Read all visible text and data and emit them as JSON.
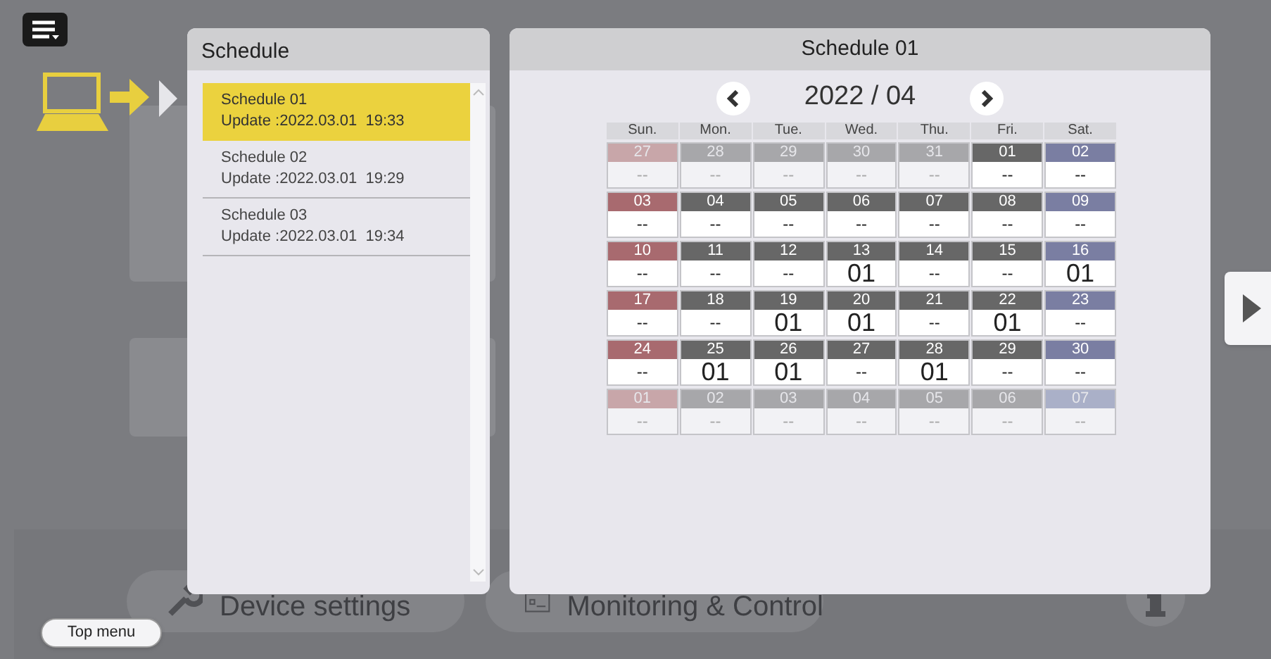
{
  "background": {
    "buttons": [
      {
        "label": "Device settings",
        "kind": "wrench"
      },
      {
        "label": "Monitoring & Control",
        "kind": "checklist"
      }
    ]
  },
  "schedule_list": {
    "title": "Schedule",
    "items": [
      {
        "name": "Schedule 01",
        "update": "Update :2022.03.01  19:33",
        "selected": true
      },
      {
        "name": "Schedule 02",
        "update": "Update :2022.03.01  19:29",
        "selected": false
      },
      {
        "name": "Schedule 03",
        "update": "Update :2022.03.01  19:34",
        "selected": false
      }
    ]
  },
  "calendar": {
    "title": "Schedule 01",
    "month": "2022 / 04",
    "weekdays": [
      "Sun.",
      "Mon.",
      "Tue.",
      "Wed.",
      "Thu.",
      "Fri.",
      "Sat."
    ],
    "weeks": [
      [
        {
          "day": "27",
          "value": "--",
          "in_month": false
        },
        {
          "day": "28",
          "value": "--",
          "in_month": false
        },
        {
          "day": "29",
          "value": "--",
          "in_month": false
        },
        {
          "day": "30",
          "value": "--",
          "in_month": false
        },
        {
          "day": "31",
          "value": "--",
          "in_month": false
        },
        {
          "day": "01",
          "value": "--",
          "in_month": true
        },
        {
          "day": "02",
          "value": "--",
          "in_month": true
        }
      ],
      [
        {
          "day": "03",
          "value": "--",
          "in_month": true
        },
        {
          "day": "04",
          "value": "--",
          "in_month": true
        },
        {
          "day": "05",
          "value": "--",
          "in_month": true
        },
        {
          "day": "06",
          "value": "--",
          "in_month": true
        },
        {
          "day": "07",
          "value": "--",
          "in_month": true
        },
        {
          "day": "08",
          "value": "--",
          "in_month": true
        },
        {
          "day": "09",
          "value": "--",
          "in_month": true
        }
      ],
      [
        {
          "day": "10",
          "value": "--",
          "in_month": true
        },
        {
          "day": "11",
          "value": "--",
          "in_month": true
        },
        {
          "day": "12",
          "value": "--",
          "in_month": true
        },
        {
          "day": "13",
          "value": "01",
          "in_month": true
        },
        {
          "day": "14",
          "value": "--",
          "in_month": true
        },
        {
          "day": "15",
          "value": "--",
          "in_month": true
        },
        {
          "day": "16",
          "value": "01",
          "in_month": true
        }
      ],
      [
        {
          "day": "17",
          "value": "--",
          "in_month": true
        },
        {
          "day": "18",
          "value": "--",
          "in_month": true
        },
        {
          "day": "19",
          "value": "01",
          "in_month": true
        },
        {
          "day": "20",
          "value": "01",
          "in_month": true
        },
        {
          "day": "21",
          "value": "--",
          "in_month": true
        },
        {
          "day": "22",
          "value": "01",
          "in_month": true
        },
        {
          "day": "23",
          "value": "--",
          "in_month": true
        }
      ],
      [
        {
          "day": "24",
          "value": "--",
          "in_month": true
        },
        {
          "day": "25",
          "value": "01",
          "in_month": true
        },
        {
          "day": "26",
          "value": "01",
          "in_month": true
        },
        {
          "day": "27",
          "value": "--",
          "in_month": true
        },
        {
          "day": "28",
          "value": "01",
          "in_month": true
        },
        {
          "day": "29",
          "value": "--",
          "in_month": true
        },
        {
          "day": "30",
          "value": "--",
          "in_month": true
        }
      ],
      [
        {
          "day": "01",
          "value": "--",
          "in_month": false
        },
        {
          "day": "02",
          "value": "--",
          "in_month": false
        },
        {
          "day": "03",
          "value": "--",
          "in_month": false
        },
        {
          "day": "04",
          "value": "--",
          "in_month": false
        },
        {
          "day": "05",
          "value": "--",
          "in_month": false
        },
        {
          "day": "06",
          "value": "--",
          "in_month": false
        },
        {
          "day": "07",
          "value": "--",
          "in_month": false
        }
      ]
    ]
  },
  "top_menu_button": "Top menu"
}
